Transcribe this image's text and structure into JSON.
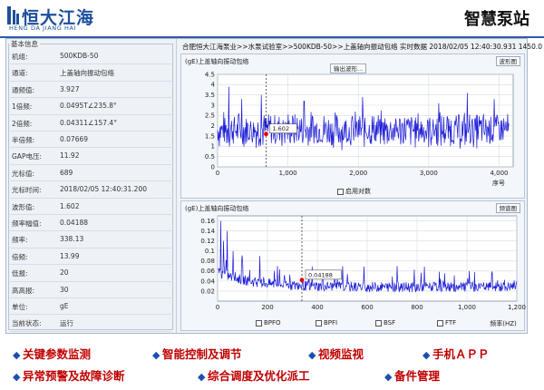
{
  "brand": {
    "name_cn": "恒大江海",
    "name_en": "HENG DA JIANG HAI",
    "title": "智慧泵站",
    "accent": "#1d4f9c"
  },
  "info": {
    "group_title": "基本信息",
    "rows": [
      {
        "label": "机组:",
        "value": "500KDB-50"
      },
      {
        "label": "通道:",
        "value": "上盖轴向振动包络"
      },
      {
        "label": "通频值:",
        "value": "3.927"
      },
      {
        "label": "1倍频:",
        "value": "0.0495T∠235.8°"
      },
      {
        "label": "2倍频:",
        "value": "0.04311∠157.4°"
      },
      {
        "label": "半倍频:",
        "value": "0.07669"
      },
      {
        "label": "GAP电压:",
        "value": "11.92"
      },
      {
        "label": "光标值:",
        "value": "689"
      },
      {
        "label": "光标时间:",
        "value": "2018/02/05 12:40:31.200"
      },
      {
        "label": "波形值:",
        "value": "1.602"
      },
      {
        "label": "频率幅值:",
        "value": "0.04188"
      },
      {
        "label": "频率:",
        "value": "338.13"
      },
      {
        "label": "倍频:",
        "value": "13.99"
      },
      {
        "label": "低报:",
        "value": "20"
      },
      {
        "label": "高高报:",
        "value": "30"
      },
      {
        "label": "单位:",
        "value": "gE"
      },
      {
        "label": "当前状态:",
        "value": "运行"
      }
    ]
  },
  "breadcrumb": "合肥恒大江海泵业>>水泵试验室>>500KDB-50>>上盖轴向振动包络 实时数据  2018/02/05 12:40:30.931  1450.0 rpm",
  "waveform_panel": {
    "title": "(gE)上盖轴向振动包络",
    "button_waveform": "输出波形...",
    "button_image": "波形图",
    "checkbox_label": "启用对数",
    "xlabel": "序号",
    "cursor_label": "1.602"
  },
  "spectrum_panel": {
    "title": "(gE)上盖轴向振动包络",
    "button_image": "频谱图",
    "xlabel": "频率(HZ)",
    "cursor_label": "0.04188",
    "filters": [
      "BPFO",
      "BPFI",
      "BSF",
      "FTF"
    ]
  },
  "chart_data": [
    {
      "type": "line",
      "title": "(gE)上盖轴向振动包络",
      "xlabel": "序号",
      "ylabel": "",
      "xlim": [
        0,
        4200
      ],
      "ylim": [
        0,
        4.5
      ],
      "xticks": [
        0,
        1000,
        2000,
        3000,
        4000
      ],
      "xtick_labels": [
        "0",
        "1,000",
        "2,000",
        "3,000",
        "4,000"
      ],
      "yticks": [
        0,
        0.5,
        1,
        1.5,
        2,
        2.5,
        3,
        3.5,
        4,
        4.5
      ],
      "ytick_labels": [
        "0",
        "0.5",
        "1",
        "1.5",
        "2",
        "2.5",
        "3",
        "3.5",
        "4",
        "4.5"
      ],
      "series": [
        {
          "color": "#1a1ad6",
          "baseline": 1.8,
          "spread": 1.0,
          "peaks": [
            [
              160,
              3.9
            ],
            [
              340,
              3.3
            ],
            [
              620,
              3.5
            ],
            [
              1230,
              3.2
            ],
            [
              2060,
              3.4
            ],
            [
              3140,
              3.1
            ],
            [
              3550,
              3.6
            ],
            [
              3930,
              3.3
            ]
          ]
        }
      ],
      "cursor": {
        "x": 689,
        "y": 1.602
      },
      "grid": true
    },
    {
      "type": "line",
      "title": "(gE)上盖轴向振动包络",
      "xlabel": "频率(HZ)",
      "ylabel": "",
      "xlim": [
        0,
        1200
      ],
      "ylim": [
        0,
        0.17
      ],
      "xticks": [
        0,
        200,
        400,
        600,
        800,
        1000,
        1200
      ],
      "xtick_labels": [
        "0",
        "200",
        "400",
        "600",
        "800",
        "1,000",
        "1,200"
      ],
      "yticks": [
        0.02,
        0.04,
        0.06,
        0.08,
        0.1,
        0.12,
        0.14,
        0.16
      ],
      "ytick_labels": [
        "0.02",
        "0.04",
        "0.06",
        "0.08",
        "0.1",
        "0.12",
        "0.14",
        "0.16"
      ],
      "series": [
        {
          "color": "#1a1ad6",
          "peaks": [
            [
              12,
              0.16
            ],
            [
              24,
              0.12
            ],
            [
              38,
              0.14
            ],
            [
              62,
              0.1
            ],
            [
              96,
              0.08
            ],
            [
              170,
              0.09
            ],
            [
              240,
              0.07
            ],
            [
              470,
              0.06
            ],
            [
              720,
              0.07
            ],
            [
              1010,
              0.06
            ],
            [
              1100,
              0.055
            ]
          ]
        }
      ],
      "cursor": {
        "x": 338.13,
        "y": 0.04188
      },
      "grid": true
    }
  ],
  "features": [
    "关键参数监测",
    "智能控制及调节",
    "视频监视",
    "手机ＡＰＰ",
    "异常预警及故障诊断",
    "综合调度及优化派工",
    "备件管理"
  ]
}
